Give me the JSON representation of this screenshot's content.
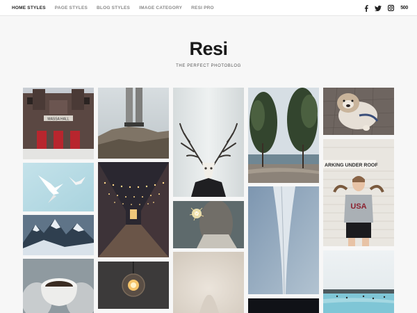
{
  "nav": {
    "items": [
      {
        "label": "HOME STYLES",
        "active": true
      },
      {
        "label": "PAGE STYLES",
        "active": false
      },
      {
        "label": "BLOG STYLES",
        "active": false
      },
      {
        "label": "IMAGE CATEGORY",
        "active": false
      },
      {
        "label": "RESI PRO",
        "active": false
      }
    ]
  },
  "social": {
    "icons": [
      "facebook-icon",
      "twitter-icon",
      "instagram-icon",
      "500px-icon"
    ],
    "px500_label": "500"
  },
  "site": {
    "title": "Resi",
    "tagline": "THE PERFECT PHOTOBLOG"
  },
  "photos": {
    "building": {
      "sign": "MASSA HALL"
    },
    "porch": {
      "sign": "ARKING UNDER ROOF"
    },
    "shirt": {
      "text": "USA"
    }
  },
  "colors": {
    "active_nav": "#222222",
    "inactive_nav": "#8a8a8a",
    "background": "#f7f7f7"
  }
}
